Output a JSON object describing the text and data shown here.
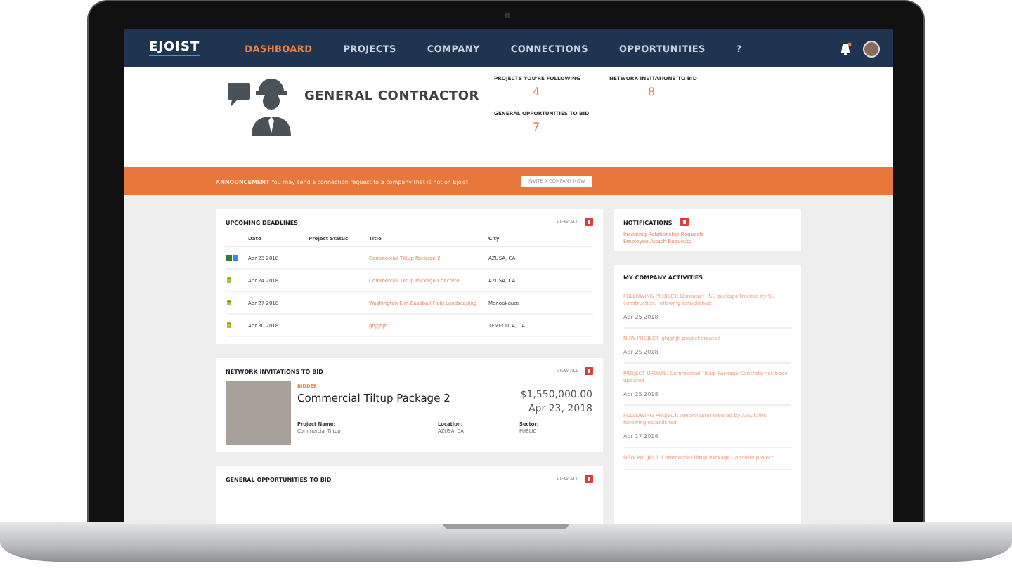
{
  "nav": {
    "logo": "EJOIST",
    "items": [
      {
        "label": "DASHBOARD",
        "selected": true
      },
      {
        "label": "PROJECTS",
        "selected": false
      },
      {
        "label": "COMPANY",
        "selected": false
      },
      {
        "label": "CONNECTIONS",
        "selected": false
      },
      {
        "label": "OPPORTUNITIES",
        "selected": false
      }
    ],
    "help": "?"
  },
  "header": {
    "title": "GENERAL CONTRACTOR",
    "stats": [
      {
        "label": "PROJECTS YOU'RE FOLLOWING",
        "value": "4"
      },
      {
        "label": "NETWORK INVITATIONS TO BID",
        "value": "8"
      },
      {
        "label": "GENERAL OPPORTUNITIES TO BID",
        "value": "7"
      }
    ]
  },
  "announcement": {
    "text": "**ANNOUNCEMENT** You may send a connection request to a company that is not on Ejoist",
    "button": "INVITE A COMPANY NOW"
  },
  "deadlines": {
    "title": "UPCOMING DEADLINES",
    "view_all": "VIEW ALL",
    "columns": [
      "Date",
      "Project Status",
      "Title",
      "City"
    ],
    "rows": [
      {
        "kind": "double",
        "date": "Apr 23 2018",
        "title": "Commercial Tiltup Package 2",
        "city": "AZUSA, CA"
      },
      {
        "kind": "single",
        "date": "Apr 24 2018",
        "title": "Commercial Tiltup Package Concrete",
        "city": "AZUSA, CA"
      },
      {
        "kind": "single",
        "date": "Apr 27 2018",
        "title": "Washington Elm Baseball Field Landscaping",
        "city": "Monoakquos"
      },
      {
        "kind": "single",
        "date": "Apr 30 2018",
        "title": "ghjghjh",
        "city": "TEMECULA, CA"
      }
    ]
  },
  "invitations": {
    "title": "NETWORK INVITATIONS TO BID",
    "view_all": "VIEW ALL",
    "item": {
      "tag": "BIDDER",
      "name": "Commercial Tiltup Package 2",
      "amount": "$1,550,000.00",
      "date": "Apr 23, 2018",
      "fields": [
        {
          "label": "Project Name:",
          "value": "Commercial Tiltup"
        },
        {
          "label": "Location:",
          "value": "AZUSA, CA"
        },
        {
          "label": "Sector:",
          "value": "PUBLIC"
        }
      ]
    }
  },
  "opportunities": {
    "title": "GENERAL OPPORTUNITIES TO BID",
    "view_all": "VIEW ALL"
  },
  "notifications": {
    "title": "NOTIFICATIONS",
    "links": [
      "Incoming Relationship Requests",
      "Employee Attach Requests"
    ]
  },
  "activities": {
    "title": "MY COMPANY ACTIVITIES",
    "items": [
      {
        "text": "FOLLOWING PROJECT: Dunratan - SE package tracked by SE construction. following established",
        "date": "Apr 25 2018"
      },
      {
        "text": "NEW PROJECT: ghjghjh project created",
        "date": "Apr 25 2018"
      },
      {
        "text": "PROJECT UPDATE: Commercial Tiltup Package Concrete has been updated",
        "date": "Apr 25 2018"
      },
      {
        "text": "FOLLOWING PROJECT: Ampitheater created by ABC Knits. following established",
        "date": "Apr 17 2018"
      },
      {
        "text": "NEW PROJECT: Commercial Tiltup Package Concrete project"
      }
    ]
  }
}
